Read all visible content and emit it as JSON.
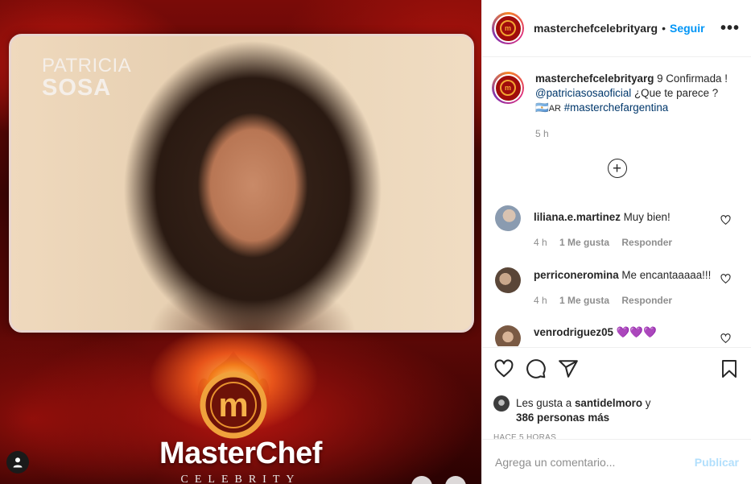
{
  "post_image": {
    "name_first": "PATRICIA",
    "name_last": "SOSA",
    "logo_letter": "m",
    "wordmark": "MasterChef",
    "subtitle": "CELEBRITY"
  },
  "header": {
    "username": "masterchefcelebrityarg",
    "separator": "•",
    "follow_label": "Seguir",
    "more_label": "•••"
  },
  "caption": {
    "username": "masterchefcelebrityarg",
    "text_1": " 9 Confirmada ! ",
    "mention": "@patriciasosaoficial",
    "text_2": " ¿Que te parece ? ",
    "flag_emoji": "🇦🇷",
    "flag_code": "AR",
    "hashtag": "#masterchefargentina",
    "time": "5 h"
  },
  "load_more_label": "+",
  "comments": [
    {
      "username": "liliana.e.martinez",
      "text": " Muy bien!",
      "time": "4 h",
      "likes": "1 Me gusta",
      "reply": "Responder"
    },
    {
      "username": "perriconeromina",
      "text": " Me encantaaaaa!!!",
      "time": "4 h",
      "likes": "1 Me gusta",
      "reply": "Responder"
    },
    {
      "username": "venrodriguez05",
      "text": " 💜💜💜"
    }
  ],
  "likes": {
    "prefix": "Les gusta a ",
    "user": "santidelmoro",
    "connector": " y",
    "others": "386 personas más"
  },
  "posted_ago": "HACE 5 HORAS",
  "add_comment": {
    "placeholder": "Agrega un comentario...",
    "publish_label": "Publicar"
  },
  "colors": {
    "accent": "#0095f6",
    "publish_disabled": "#b2dffc",
    "link": "#00376b",
    "muted": "#8e8e8e"
  }
}
